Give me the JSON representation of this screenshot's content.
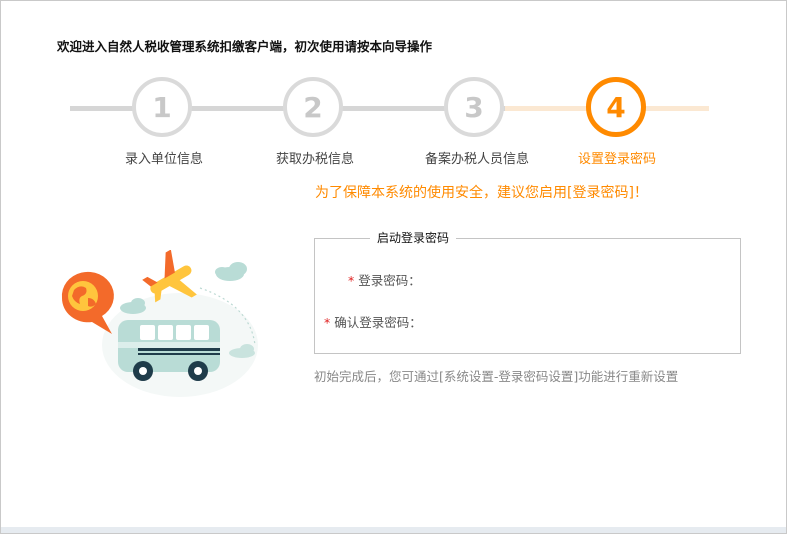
{
  "header": {
    "welcome_text": "欢迎进入自然人税收管理系统扣缴客户端，初次使用请按本向导操作"
  },
  "wizard": {
    "steps": [
      {
        "number": "1",
        "label": "录入单位信息",
        "state": "inactive"
      },
      {
        "number": "2",
        "label": "获取办税信息",
        "state": "inactive"
      },
      {
        "number": "3",
        "label": "备案办税人员信息",
        "state": "inactive"
      },
      {
        "number": "4",
        "label": "设置登录密码",
        "state": "active"
      }
    ],
    "colors": {
      "active": "#ff8a00",
      "inactive": "#dadada",
      "active_track": "#fbe8d2",
      "inactive_track": "#d6d6d6"
    }
  },
  "security_tip": "为了保障本系统的使用安全，建议您启用[登录密码]！",
  "password_section": {
    "legend": "启动登录密码",
    "fields": [
      {
        "label": "登录密码：",
        "value": "",
        "required": "*"
      },
      {
        "label": "确认登录密码：",
        "value": "",
        "required": "*"
      }
    ]
  },
  "hint_text": "初始完成后，您可通过[系统设置-登录密码设置]功能进行重新设置",
  "illustration": {
    "icons": [
      "globe-speech-icon",
      "airplane-icon",
      "bus-icon",
      "cloud-icon"
    ]
  }
}
